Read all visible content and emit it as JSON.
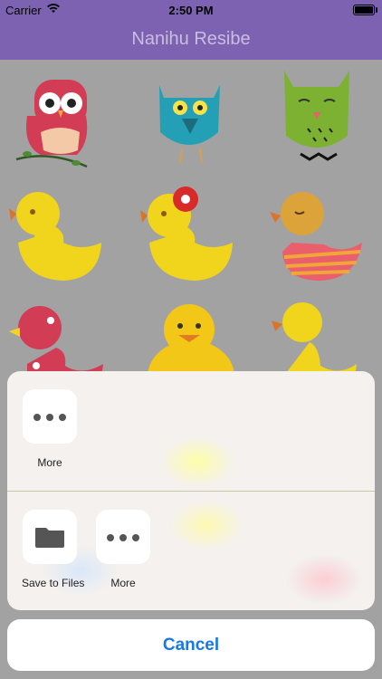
{
  "status_bar": {
    "carrier": "Carrier",
    "time": "2:50 PM"
  },
  "navbar": {
    "title": "Nanihu Resibe"
  },
  "share_sheet": {
    "top_row": [
      {
        "label": "More",
        "icon": "more-icon"
      }
    ],
    "bottom_row": [
      {
        "label": "Save to Files",
        "icon": "folder-icon"
      },
      {
        "label": "More",
        "icon": "more-icon"
      }
    ],
    "cancel_label": "Cancel"
  },
  "colors": {
    "nav": "#7e62b2",
    "accent": "#1778ea"
  }
}
